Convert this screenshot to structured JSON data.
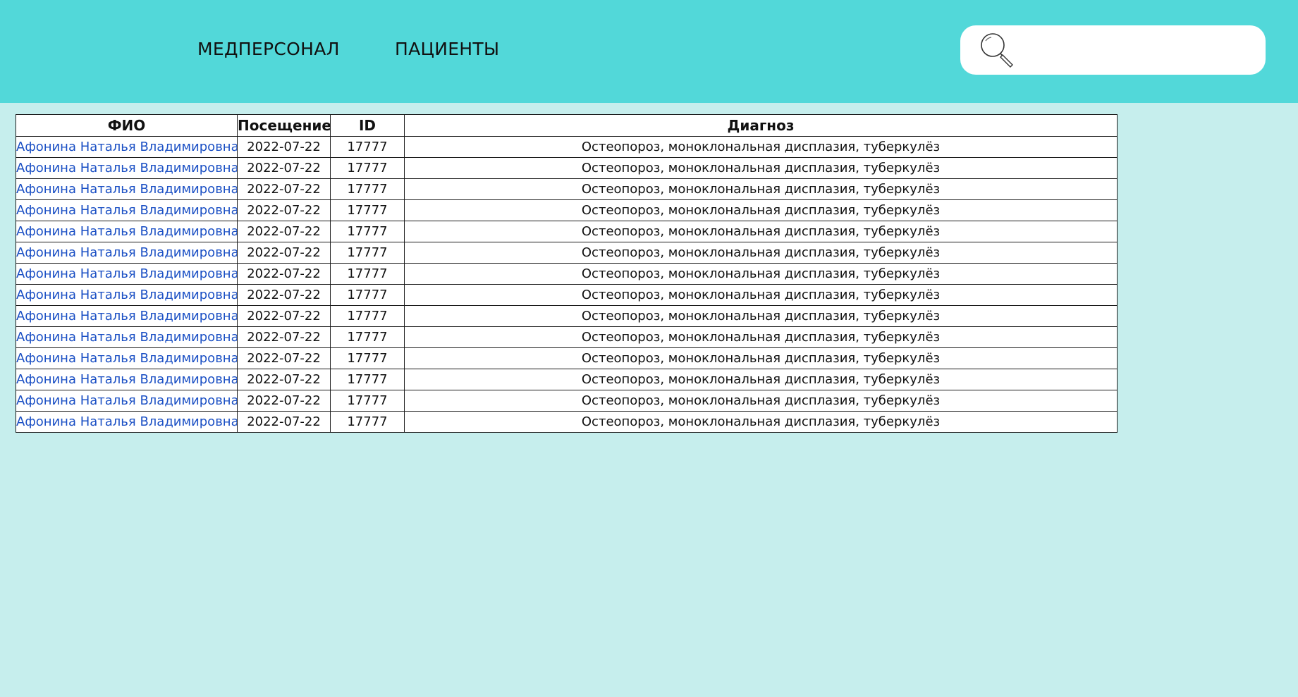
{
  "nav": {
    "staff_label": "МЕДПЕРСОНАЛ",
    "patients_label": "ПАЦИЕНТЫ"
  },
  "search": {
    "icon": "magnifier-icon",
    "placeholder": "",
    "value": ""
  },
  "colors": {
    "header_bg": "#52d8d9",
    "page_bg": "#c6eeed",
    "link": "#1a4fc4"
  },
  "table": {
    "headers": [
      "ФИО",
      "Посещение",
      "ID",
      "Диагноз"
    ],
    "rows": [
      {
        "name": "Афонина Наталья Владимировна",
        "visit": "2022-07-22",
        "id": "17777",
        "diagnosis": "Остеопороз, моноклональная дисплазия, туберкулёз"
      },
      {
        "name": "Афонина Наталья Владимировна",
        "visit": "2022-07-22",
        "id": "17777",
        "diagnosis": "Остеопороз, моноклональная дисплазия, туберкулёз"
      },
      {
        "name": "Афонина Наталья Владимировна",
        "visit": "2022-07-22",
        "id": "17777",
        "diagnosis": "Остеопороз, моноклональная дисплазия, туберкулёз"
      },
      {
        "name": "Афонина Наталья Владимировна",
        "visit": "2022-07-22",
        "id": "17777",
        "diagnosis": "Остеопороз, моноклональная дисплазия, туберкулёз"
      },
      {
        "name": "Афонина Наталья Владимировна",
        "visit": "2022-07-22",
        "id": "17777",
        "diagnosis": "Остеопороз, моноклональная дисплазия, туберкулёз"
      },
      {
        "name": "Афонина Наталья Владимировна",
        "visit": "2022-07-22",
        "id": "17777",
        "diagnosis": "Остеопороз, моноклональная дисплазия, туберкулёз"
      },
      {
        "name": "Афонина Наталья Владимировна",
        "visit": "2022-07-22",
        "id": "17777",
        "diagnosis": "Остеопороз, моноклональная дисплазия, туберкулёз"
      },
      {
        "name": "Афонина Наталья Владимировна",
        "visit": "2022-07-22",
        "id": "17777",
        "diagnosis": "Остеопороз, моноклональная дисплазия, туберкулёз"
      },
      {
        "name": "Афонина Наталья Владимировна",
        "visit": "2022-07-22",
        "id": "17777",
        "diagnosis": "Остеопороз, моноклональная дисплазия, туберкулёз"
      },
      {
        "name": "Афонина Наталья Владимировна",
        "visit": "2022-07-22",
        "id": "17777",
        "diagnosis": "Остеопороз, моноклональная дисплазия, туберкулёз"
      },
      {
        "name": "Афонина Наталья Владимировна",
        "visit": "2022-07-22",
        "id": "17777",
        "diagnosis": "Остеопороз, моноклональная дисплазия, туберкулёз"
      },
      {
        "name": "Афонина Наталья Владимировна",
        "visit": "2022-07-22",
        "id": "17777",
        "diagnosis": "Остеопороз, моноклональная дисплазия, туберкулёз"
      },
      {
        "name": "Афонина Наталья Владимировна",
        "visit": "2022-07-22",
        "id": "17777",
        "diagnosis": "Остеопороз, моноклональная дисплазия, туберкулёз"
      },
      {
        "name": "Афонина Наталья Владимировна",
        "visit": "2022-07-22",
        "id": "17777",
        "diagnosis": "Остеопороз, моноклональная дисплазия, туберкулёз"
      }
    ]
  }
}
